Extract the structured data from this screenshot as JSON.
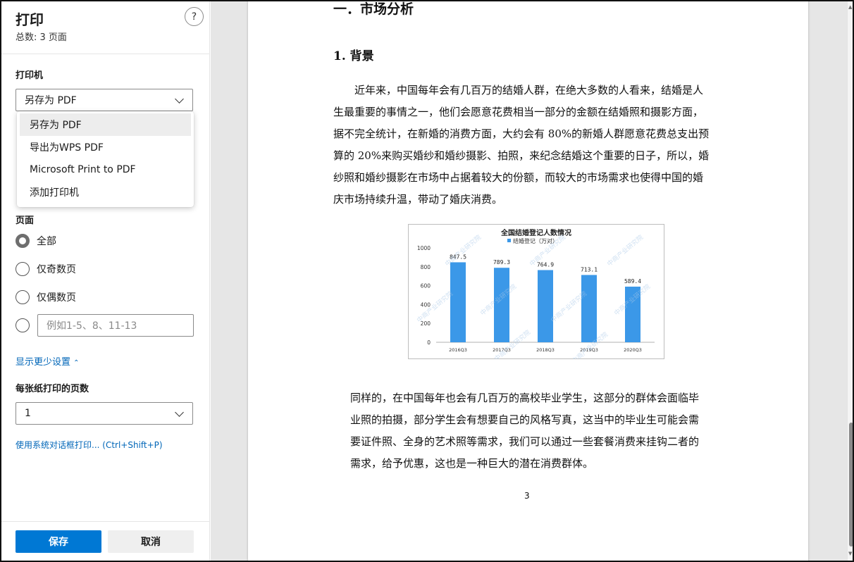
{
  "panel": {
    "title": "打印",
    "subtitle": "总数: 3 页面",
    "help": "?",
    "printer_label": "打印机",
    "printer_selected": "另存为 PDF",
    "printer_options": [
      "另存为 PDF",
      "导出为WPS PDF",
      "Microsoft Print to PDF",
      "添加打印机"
    ],
    "pages_label": "页面",
    "page_options": [
      "全部",
      "仅奇数页",
      "仅偶数页"
    ],
    "range_placeholder": "例如1-5、8、11-13",
    "more_settings": "显示更少设置",
    "per_sheet_label": "每张纸打印的页数",
    "per_sheet_value": "1",
    "system_dialog": "使用系统对话框打印... (Ctrl+Shift+P)",
    "save": "保存",
    "cancel": "取消",
    "accent": "#0078d4"
  },
  "doc": {
    "heading1": "一．市场分析",
    "heading2": "1. 背景",
    "para1_lines": [
      "　　近年来，中国每年会有几百万的结婚人群，在绝大多数的人看来，结婚是人",
      "生最重要的事情之一，他们会愿意花费相当一部分的金额在结婚照和摄影方面，",
      "据不完全统计，在新婚的消费方面，大约会有 80%的新婚人群愿意花费总支出预",
      "算的 20%来购买婚纱和婚纱摄影、拍照，来纪念结婚这个重要的日子，所以，婚",
      "纱照和婚纱摄影在市场中占据着较大的份额，而较大的市场需求也使得中国的婚",
      "庆市场持续升温，带动了婚庆消费。"
    ],
    "para2_lines": [
      "同样的，在中国每年也会有几百万的高校毕业学生，这部分的群体会面临毕",
      "业照的拍摄，部分学生会有想要自己的风格写真，这当中的毕业生可能会需",
      "要证件照、全身的艺术照等需求，我们可以通过一些套餐消费来挂钩二者的",
      "需求，给予优惠，这也是一种巨大的潜在消费群体。"
    ],
    "page_number": "3"
  },
  "chart_data": {
    "type": "bar",
    "title": "全国结婚登记人数情况",
    "legend": "结婚登记（万对）",
    "categories": [
      "2016Q3",
      "2017Q3",
      "2018Q3",
      "2019Q3",
      "2020Q3"
    ],
    "series": [
      {
        "name": "结婚登记（万对）",
        "values": [
          847.5,
          789.3,
          764.9,
          713.1,
          589.4
        ],
        "color": "#3b98e8"
      }
    ],
    "value_labels": [
      "847.5",
      "789.3",
      "764.9",
      "713.1",
      "589.4"
    ],
    "yticks": [
      "0",
      "200",
      "400",
      "600",
      "800",
      "1000"
    ],
    "ylim": [
      0,
      1000
    ],
    "watermark": "中商产业研究院",
    "legend_position": "top"
  }
}
